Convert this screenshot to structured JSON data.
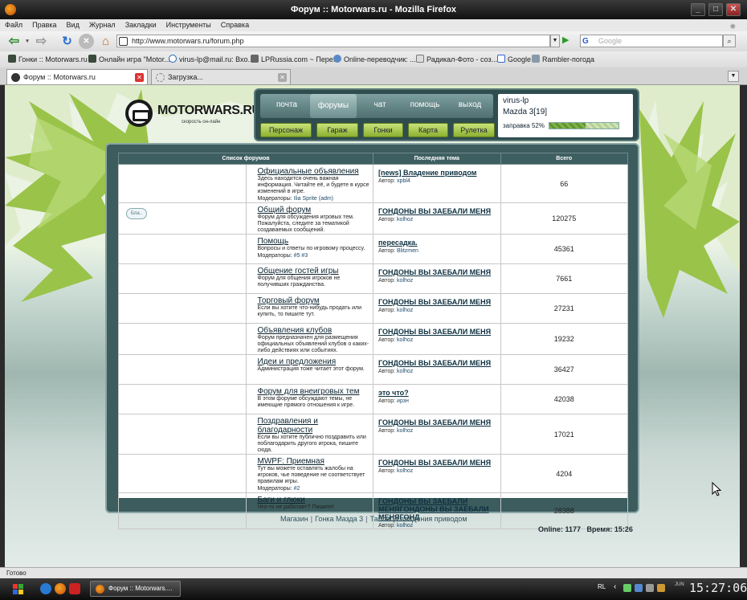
{
  "window": {
    "title": "Форум :: Motorwars.ru - Mozilla Firefox"
  },
  "menu": [
    "Файл",
    "Правка",
    "Вид",
    "Журнал",
    "Закладки",
    "Инструменты",
    "Справка"
  ],
  "address": {
    "url": "http://www.motorwars.ru/forum.php",
    "search_placeholder": "Google"
  },
  "bookmarks": [
    "Гонки :: Motorwars.ru",
    "Онлайн игра \"Motor...",
    "virus-lp@mail.ru: Вхо...",
    "LPRussia.com ~ Пере...",
    "Online-переводчик: ...",
    "Радикал-Фото - соз...",
    "Google",
    "Rambler-погода"
  ],
  "tabs": [
    {
      "label": "Форум :: Motorwars.ru",
      "active": true
    },
    {
      "label": "Загрузка...",
      "active": false
    }
  ],
  "site": {
    "logo_name": "MOTORWARS.RU",
    "logo_sub": "скорость он-лайн",
    "nav_top": [
      "почта",
      "форумы",
      "чат",
      "помощь",
      "выход"
    ],
    "nav_active": "форумы",
    "nav_bottom": [
      "Персонаж",
      "Гараж",
      "Гонки",
      "Карта",
      "Рулетка"
    ],
    "user": {
      "name": "virus-lp",
      "car": "Mazda 3[19]",
      "fuel_label": "заправка 52%",
      "fuel_percent": 52
    }
  },
  "forum": {
    "headers": [
      "Список форумов",
      "Последняя тема",
      "Всего"
    ],
    "rows": [
      {
        "title": "Официальные объявления",
        "desc": "Здесь находится очень важная информация. Читайте её, и будете в курсе изменений в игре.",
        "mods_label": "Модераторы:",
        "mods": "Ilia Sprite (adm)",
        "last_topic": "[news] Владение приводом",
        "author_label": "Автор:",
        "author": "xpbl4",
        "total": "66",
        "icon": ""
      },
      {
        "title": "Общий форум",
        "desc": "Форум для обсуждения игровых тем. Пожалуйста, следите за тематикой создаваемых сообщений.",
        "mods_label": "",
        "mods": "",
        "last_topic": "ГОНДОНЫ ВЫ ЗАЕБАЛИ МЕНЯ",
        "author_label": "Автор:",
        "author": "kolhoz",
        "total": "120275",
        "icon": "chat-bubbles"
      },
      {
        "title": "Помощь",
        "desc": "Вопросы и ответы по игровому процессу.",
        "mods_label": "Модераторы:",
        "mods": "#5 #3",
        "last_topic": "пересадка.",
        "author_label": "Автор:",
        "author": "Blitzmen",
        "total": "45361",
        "icon": ""
      },
      {
        "title": "Общение гостей игры",
        "desc": "Форум для общения игроков не получивших гражданства.",
        "mods_label": "",
        "mods": "",
        "last_topic": "ГОНДОНЫ ВЫ ЗАЕБАЛИ МЕНЯ",
        "author_label": "Автор:",
        "author": "kolhoz",
        "total": "7661",
        "icon": ""
      },
      {
        "title": "Торговый форум",
        "desc": "Если вы хотите что-нибудь продать или купить, то пишите тут.",
        "mods_label": "",
        "mods": "",
        "last_topic": "ГОНДОНЫ ВЫ ЗАЕБАЛИ МЕНЯ",
        "author_label": "Автор:",
        "author": "kolhoz",
        "total": "27231",
        "icon": ""
      },
      {
        "title": "Объявления клубов",
        "desc": "Форум предназначен для размещения официальных объявлений клубов о каких-либо действиях или событиях.",
        "mods_label": "",
        "mods": "",
        "last_topic": "ГОНДОНЫ ВЫ ЗАЕБАЛИ МЕНЯ",
        "author_label": "Автор:",
        "author": "kolhoz",
        "total": "19232",
        "icon": ""
      },
      {
        "title": "Идеи и предложения",
        "desc": "Администрация тоже читает этот форум.",
        "mods_label": "",
        "mods": "",
        "last_topic": "ГОНДОНЫ ВЫ ЗАЕБАЛИ МЕНЯ",
        "author_label": "Автор:",
        "author": "kolhoz",
        "total": "36427",
        "icon": ""
      },
      {
        "title": "Форум для внеигровых тем",
        "desc": "В этом форуме обсуждают темы, не имеющие прямого отношения к игре.",
        "mods_label": "",
        "mods": "",
        "last_topic": "это что?",
        "author_label": "Автор:",
        "author": "ирзн",
        "total": "42038",
        "icon": ""
      },
      {
        "title": "Поздравления и благодарности",
        "desc": "Если вы хотите публично поздравить или поблагодарить другого игрока, пишите сюда.",
        "mods_label": "",
        "mods": "",
        "last_topic": "ГОНДОНЫ ВЫ ЗАЕБАЛИ МЕНЯ",
        "author_label": "Автор:",
        "author": "kolhoz",
        "total": "17021",
        "icon": ""
      },
      {
        "title": "MWPF: Приемная",
        "desc": "Тут вы можете оставлять жалобы на игроков, чье поведение не соответствует правилам игры.",
        "mods_label": "Модераторы:",
        "mods": "#2",
        "last_topic": "ГОНДОНЫ ВЫ ЗАЕБАЛИ МЕНЯ",
        "author_label": "Автор:",
        "author": "kolhoz",
        "total": "4204",
        "icon": ""
      },
      {
        "title": "Баги и глюки",
        "desc": "Что-то не работает? Пишите!",
        "mods_label": "",
        "mods": "",
        "last_topic": "ГОНДОНЫ ВЫ ЗАЕБАЛИ МЕНЯГОНДОНЫ ВЫ ЗАЕБАЛИ МЕНЯГОНД",
        "author_label": "Автор:",
        "author": "kolhoz",
        "total": "28388",
        "icon": ""
      }
    ]
  },
  "footer": {
    "links": [
      "Магазин",
      "Гонка Мазда 3",
      "Таблица владения приводом"
    ],
    "online": "Online: 1177",
    "time": "Время: 15:26"
  },
  "status": "Готово",
  "taskbar": {
    "task": "Форум :: Motorwars....",
    "lang": "RL",
    "day": "JUN",
    "clock": "15:27:06"
  },
  "colors": {
    "panel": "#2f4d4f",
    "header": "#3e5f61",
    "green_button": "#8cb030",
    "leaf": "#9ac34a"
  }
}
